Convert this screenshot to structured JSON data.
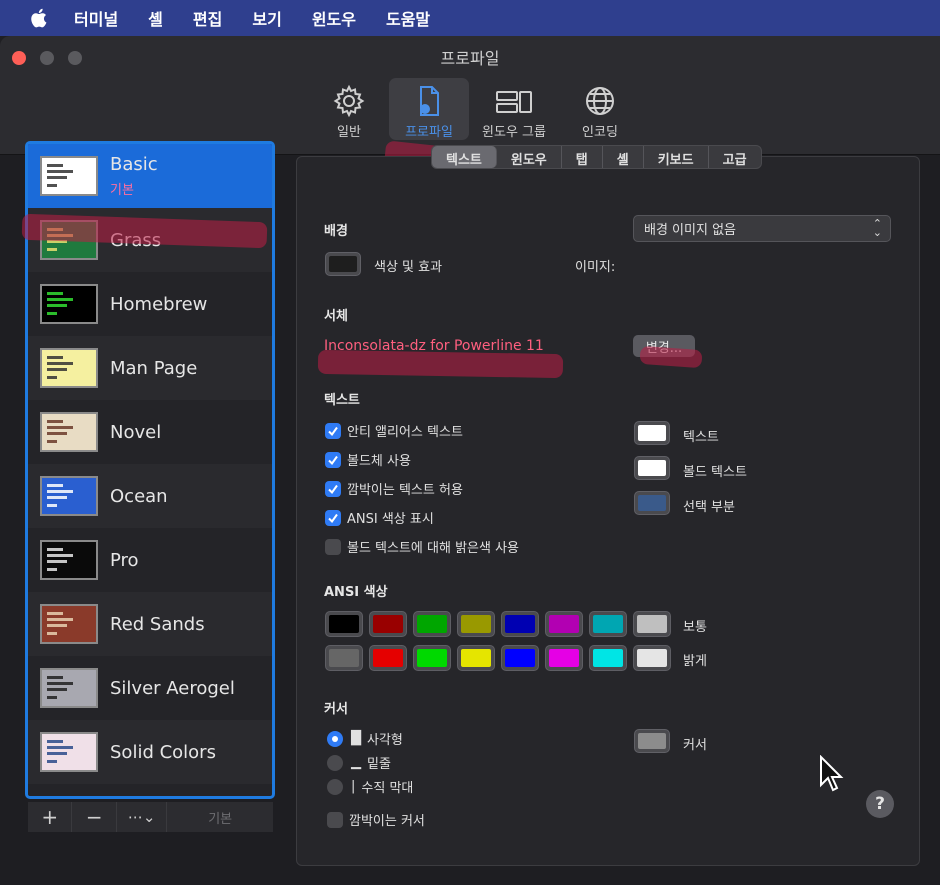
{
  "menubar": {
    "items": [
      "터미널",
      "셸",
      "편집",
      "보기",
      "윈도우",
      "도움말"
    ]
  },
  "window": {
    "title": "프로파일",
    "toolbar": [
      {
        "label": "일반",
        "icon": "gear-icon"
      },
      {
        "label": "프로파일",
        "icon": "profile-document-icon",
        "active": true
      },
      {
        "label": "윈도우 그룹",
        "icon": "window-group-icon"
      },
      {
        "label": "인코딩",
        "icon": "globe-icon"
      }
    ]
  },
  "sidebar": {
    "profiles": [
      {
        "name": "Basic",
        "sub": "기본",
        "selected": true,
        "bg": "#ffffff",
        "fg": "#333333"
      },
      {
        "name": "Grass",
        "bg": "#1f7a3e",
        "fg": "#e8e070"
      },
      {
        "name": "Homebrew",
        "bg": "#000000",
        "fg": "#33dd33"
      },
      {
        "name": "Man Page",
        "bg": "#f5f0a0",
        "fg": "#333333"
      },
      {
        "name": "Novel",
        "bg": "#e8dcc4",
        "fg": "#6a3a2a"
      },
      {
        "name": "Ocean",
        "bg": "#2a5fd0",
        "fg": "#ffffff"
      },
      {
        "name": "Pro",
        "bg": "#0a0a0a",
        "fg": "#e6e6e6"
      },
      {
        "name": "Red Sands",
        "bg": "#8a3a2a",
        "fg": "#e8d0b0"
      },
      {
        "name": "Silver Aerogel",
        "bg": "#a8a8b0",
        "fg": "#202020"
      },
      {
        "name": "Solid Colors",
        "bg": "#f0e0e8",
        "fg": "#2a4a8a"
      }
    ],
    "buttons": {
      "add": "+",
      "remove": "−",
      "more": "⋯⌄",
      "default": "기본"
    }
  },
  "tabs": [
    "텍스트",
    "윈도우",
    "탭",
    "셸",
    "키보드",
    "고급"
  ],
  "active_tab": "텍스트",
  "background": {
    "title": "배경",
    "color_label": "색상 및 효과",
    "image_label": "이미지:",
    "image_value": "배경 이미지 없음",
    "color": "#1e1e1e"
  },
  "font": {
    "title": "서체",
    "value": "Inconsolata-dz for Powerline 11",
    "change": "변경..."
  },
  "text": {
    "title": "텍스트",
    "checkboxes": [
      {
        "label": "안티 앨리어스 텍스트",
        "checked": true
      },
      {
        "label": "볼드체 사용",
        "checked": true
      },
      {
        "label": "깜박이는 텍스트 허용",
        "checked": true
      },
      {
        "label": "ANSI 색상 표시",
        "checked": true
      },
      {
        "label": "볼드 텍스트에 대해 밝은색 사용",
        "checked": false
      }
    ],
    "wells": [
      {
        "label": "텍스트",
        "color": "#ffffff"
      },
      {
        "label": "볼드 텍스트",
        "color": "#ffffff"
      },
      {
        "label": "선택 부분",
        "color": "#3a5a8a"
      }
    ]
  },
  "ansi": {
    "title": "ANSI 색상",
    "normal_label": "보통",
    "bright_label": "밝게",
    "normal": [
      "#000000",
      "#990000",
      "#00a600",
      "#999900",
      "#0000b2",
      "#b200b2",
      "#00a6b2",
      "#bfbfbf"
    ],
    "bright": [
      "#666666",
      "#e50000",
      "#00d900",
      "#e5e500",
      "#0000ff",
      "#e500e5",
      "#00e5e5",
      "#e5e5e5"
    ]
  },
  "cursor": {
    "title": "커서",
    "options": [
      {
        "glyph": "█",
        "label": "사각형",
        "selected": true
      },
      {
        "glyph": "▁",
        "label": "밑줄",
        "selected": false
      },
      {
        "glyph": "|",
        "label": "수직 막대",
        "selected": false
      }
    ],
    "blink_label": "깜박이는 커서",
    "blink_checked": false,
    "well_label": "커서",
    "color": "#8c8c8c"
  },
  "help": "?"
}
